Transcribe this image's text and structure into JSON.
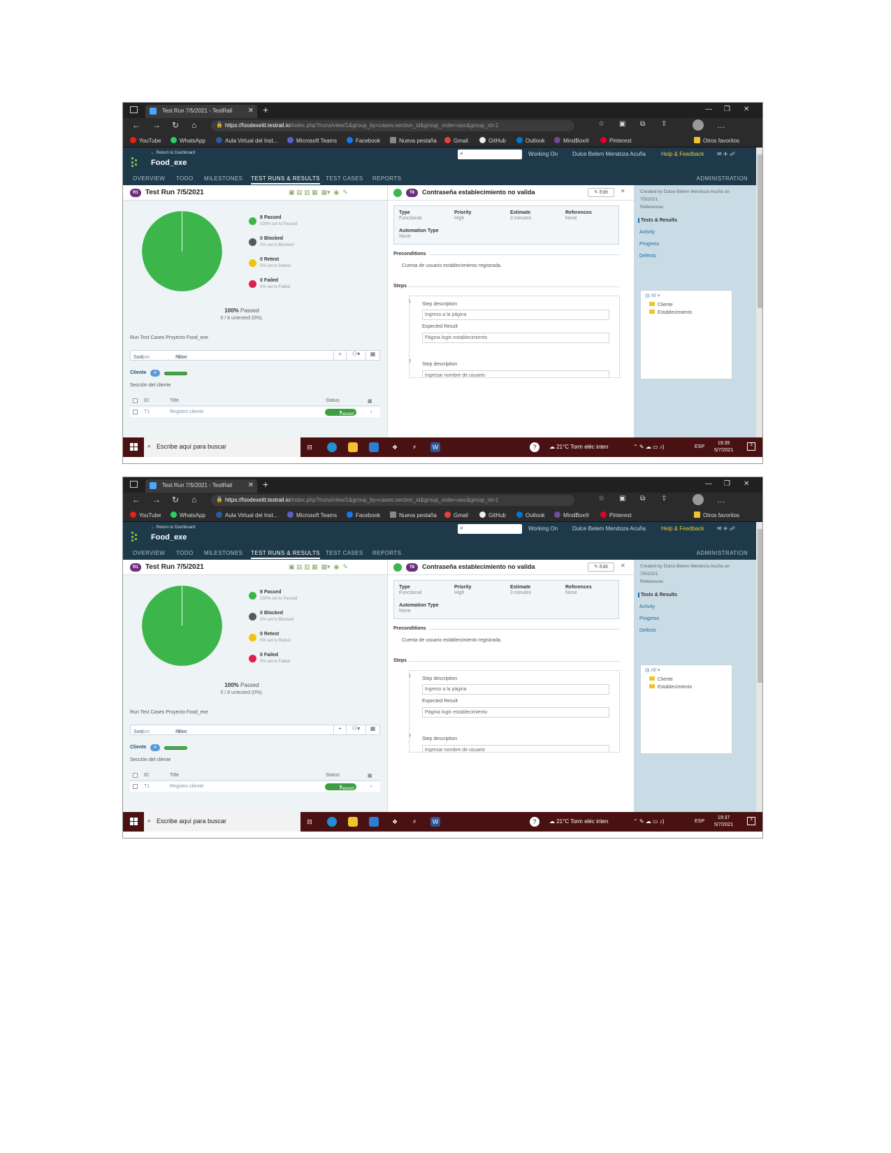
{
  "browser": {
    "tab_title": "Test Run 7/5/2021 - TestRail",
    "url_host": "https://foodexeitt.testrail.io",
    "url_rest": "/index.php?/runs/view/1&group_by=cases:section_id&group_order=asc&group_id=1",
    "bookmarks": [
      "YouTube",
      "WhatsApp",
      "Aula Virtual del Inst...",
      "Microsoft Teams",
      "Facebook",
      "Nueva pestaña",
      "Gmail",
      "GitHub",
      "Outlook",
      "MindBox®",
      "Pinterest"
    ],
    "bookmarks_other": "Otros favoritos"
  },
  "testrail": {
    "back_link": "← Return to Dashboard",
    "project": "Food_exe",
    "working_on": "Working On",
    "user": "Dulce Belem Mendoza Acuña",
    "help": "Help & Feedback",
    "nav": [
      "OVERVIEW",
      "TODO",
      "MILESTONES",
      "TEST RUNS & RESULTS",
      "TEST CASES",
      "REPORTS"
    ],
    "admin": "ADMINISTRATION"
  },
  "run": {
    "badge": "R1",
    "title": "Test Run 7/5/2021",
    "legend": [
      {
        "main": "8 Passed",
        "sub": "100% set to Passed",
        "color": "#3cb54a"
      },
      {
        "main": "0 Blocked",
        "sub": "0% set to Blocked",
        "color": "#555a5e"
      },
      {
        "main": "0 Retest",
        "sub": "0% set to Retest",
        "color": "#f4c20d"
      },
      {
        "main": "0 Failed",
        "sub": "0% set to Failed",
        "color": "#e0204a"
      }
    ],
    "pass_pct": "100%",
    "pass_word": "Passed",
    "untested": "0 / 8 untested (0%).",
    "description": "Run Test Cases Proyecto Food_exe",
    "sort_label": "Sort:",
    "sort_value": "Section",
    "filter_label": "Filter:",
    "filter_value": "None",
    "group": {
      "name": "Cliente",
      "count": "4",
      "description": "Sección del cliente"
    },
    "columns": {
      "id": "ID",
      "title": "Title",
      "status": "Status"
    },
    "row": {
      "id": "T1",
      "title": "Registro cliente",
      "status": "Passed"
    }
  },
  "case": {
    "badge": "T8",
    "title": "Contraseña establecimiento no valida",
    "edit": "Edit",
    "props": {
      "type_label": "Type",
      "type_value": "Functional",
      "priority_label": "Priority",
      "priority_value": "High",
      "estimate_label": "Estimate",
      "estimate_value": "3 minutes",
      "references_label": "References",
      "references_value": "None",
      "automation_label": "Automation Type",
      "automation_value": "None"
    },
    "preconditions_title": "Preconditions",
    "preconditions": "Cuenta de usuario establecimiento registrada.",
    "steps_title": "Steps",
    "steps": [
      {
        "num": "1",
        "desc_label": "Step description",
        "desc": "Ingreso a la página",
        "exp_label": "Expected Result",
        "expected": "Página login establecimiento"
      },
      {
        "num": "2",
        "desc_label": "Step description",
        "desc": "Ingresar nombre de usuario"
      }
    ]
  },
  "sidebar": {
    "created": "Created by Dulce Belem Mendoza Acuña on 7/5/2021.",
    "references": "References",
    "links": [
      "Tests & Results",
      "Activity",
      "Progress",
      "Defects"
    ],
    "tree_all": "All",
    "tree_items": [
      "Cliente",
      "Establecimiento"
    ]
  },
  "taskbar": {
    "search": "Escribe aquí para buscar",
    "weather": "21°C  Torm eléc inten",
    "lang": "ESP",
    "date": "5/7/2021",
    "time_1": "19:35",
    "time_2": "19:37",
    "notif": "3"
  }
}
